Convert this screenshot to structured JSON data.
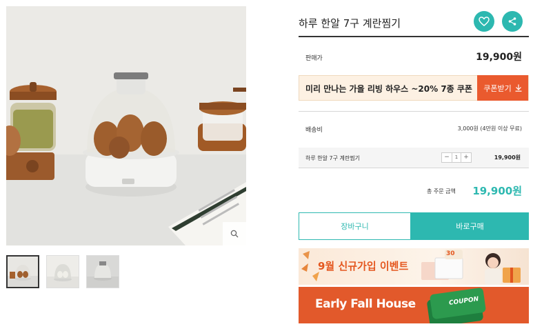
{
  "product": {
    "title": "하루 한알 7구 계란찜기"
  },
  "price_row": {
    "label": "판매가",
    "value": "19,900원"
  },
  "coupon": {
    "text": "미리 만나는 가을 리빙 하우스 ~20% 7종 쿠폰",
    "button_label": "쿠폰받기"
  },
  "shipping": {
    "label": "배송비",
    "value": "3,000원 (4만원 이상 무료)"
  },
  "option": {
    "name": "하루 한알 7구 계란찜기",
    "quantity": "1",
    "minus": "−",
    "plus": "+",
    "price": "19,900원"
  },
  "total": {
    "label": "총 주문 금액",
    "value": "19,900원"
  },
  "actions": {
    "cart_label": "장바구니",
    "buy_label": "바로구매"
  },
  "banners": {
    "signup_event": "9월 신규가입 이벤트",
    "signup_badge": "30",
    "fall_house": "Early Fall House",
    "coupon_tag": "COUPON"
  },
  "icons": {
    "wishlist": "heart-icon",
    "share": "share-icon",
    "zoom": "search-icon",
    "download": "download-icon"
  },
  "colors": {
    "accent": "#2db8b0",
    "coupon_orange": "#ea5a2e",
    "banner_orange": "#e2592b"
  },
  "gallery": {
    "thumbnail_count": 3,
    "active_thumbnail": 1
  }
}
